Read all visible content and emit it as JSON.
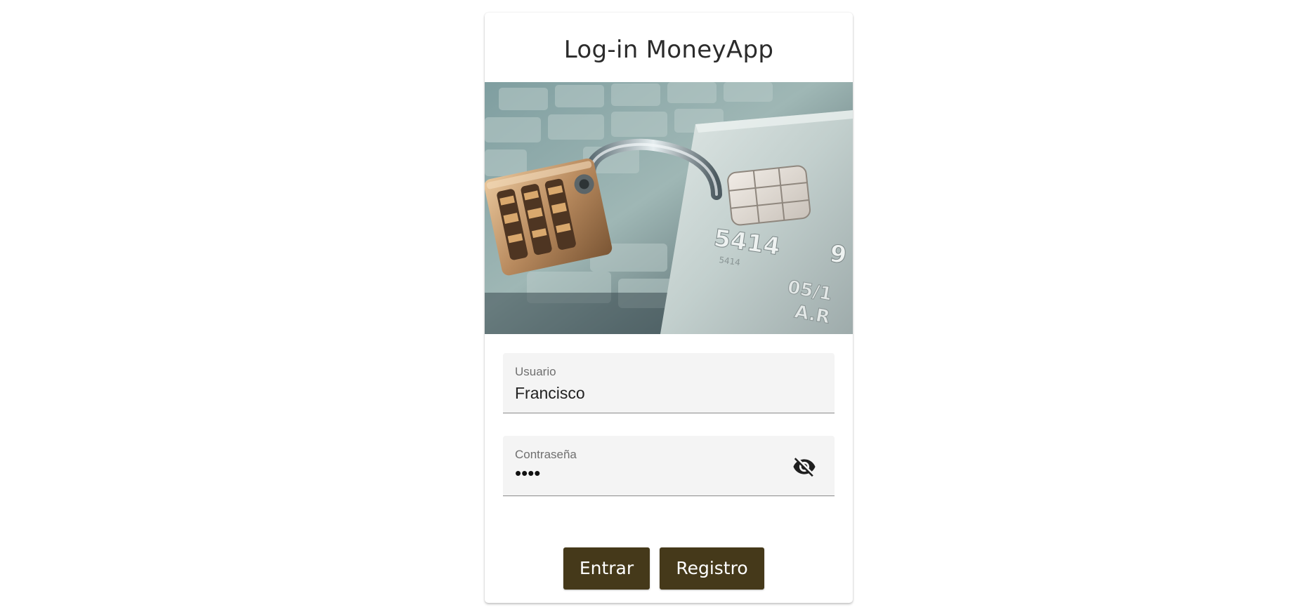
{
  "app": {
    "title": "Log-in MoneyApp"
  },
  "hero_image": {
    "subject": "padlock locking a credit card on a keyboard",
    "card_number_text": "5414"
  },
  "form": {
    "username": {
      "label": "Usuario",
      "value": "Francisco"
    },
    "password": {
      "label": "Contraseña",
      "masked_value": "••••",
      "toggle_icon": "visibility-off-icon"
    }
  },
  "buttons": {
    "enter_label": "Entrar",
    "register_label": "Registro"
  },
  "colors": {
    "button_background": "#45391a",
    "button_text": "#ffffff",
    "field_background": "#f4f4f4",
    "page_background": "#ffffff"
  }
}
